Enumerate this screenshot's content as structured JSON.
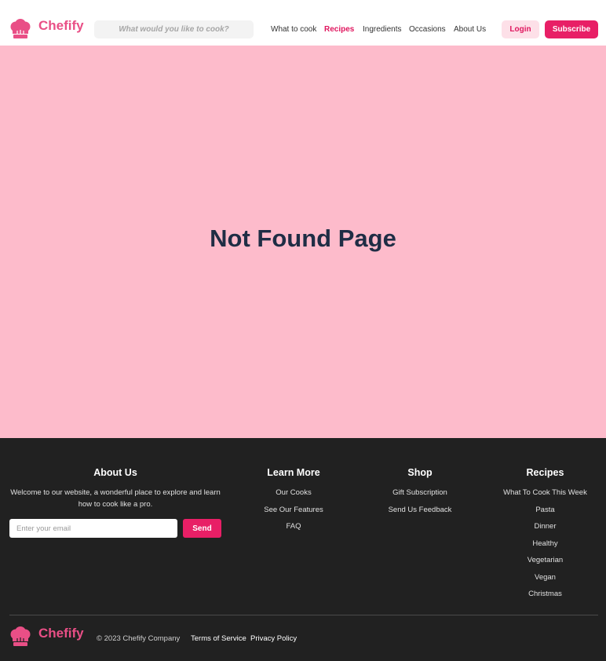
{
  "brand": {
    "name": "Chefify",
    "color": "#e94f86",
    "icon": "chef-hat-icon"
  },
  "header": {
    "search_placeholder": "What would you like to cook?",
    "nav": [
      {
        "label": "What to cook",
        "active": false
      },
      {
        "label": "Recipes",
        "active": true
      },
      {
        "label": "Ingredients",
        "active": false
      },
      {
        "label": "Occasions",
        "active": false
      },
      {
        "label": "About Us",
        "active": false
      }
    ],
    "login_label": "Login",
    "subscribe_label": "Subscribe"
  },
  "main": {
    "message": "Not Found Page",
    "background": "#fdbbcb"
  },
  "footer": {
    "about": {
      "title": "About Us",
      "text": "Welcome to our website, a wonderful place to explore and learn how to cook like a pro.",
      "email_placeholder": "Enter your email",
      "send_label": "Send"
    },
    "learn_more": {
      "title": "Learn More",
      "links": [
        "Our Cooks",
        "See Our Features",
        "FAQ"
      ]
    },
    "shop": {
      "title": "Shop",
      "links": [
        "Gift Subscription",
        "Send Us Feedback"
      ]
    },
    "recipes": {
      "title": "Recipes",
      "links": [
        "What To Cook This Week",
        "Pasta",
        "Dinner",
        "Healthy",
        "Vegetarian",
        "Vegan",
        "Christmas"
      ]
    },
    "copyright": "© 2023 Chefify Company",
    "terms_label": "Terms of Service",
    "privacy_label": "Privacy Policy"
  },
  "colors": {
    "accent": "#e81f66",
    "footer_bg": "#212121",
    "title_text": "#1f2d45"
  }
}
